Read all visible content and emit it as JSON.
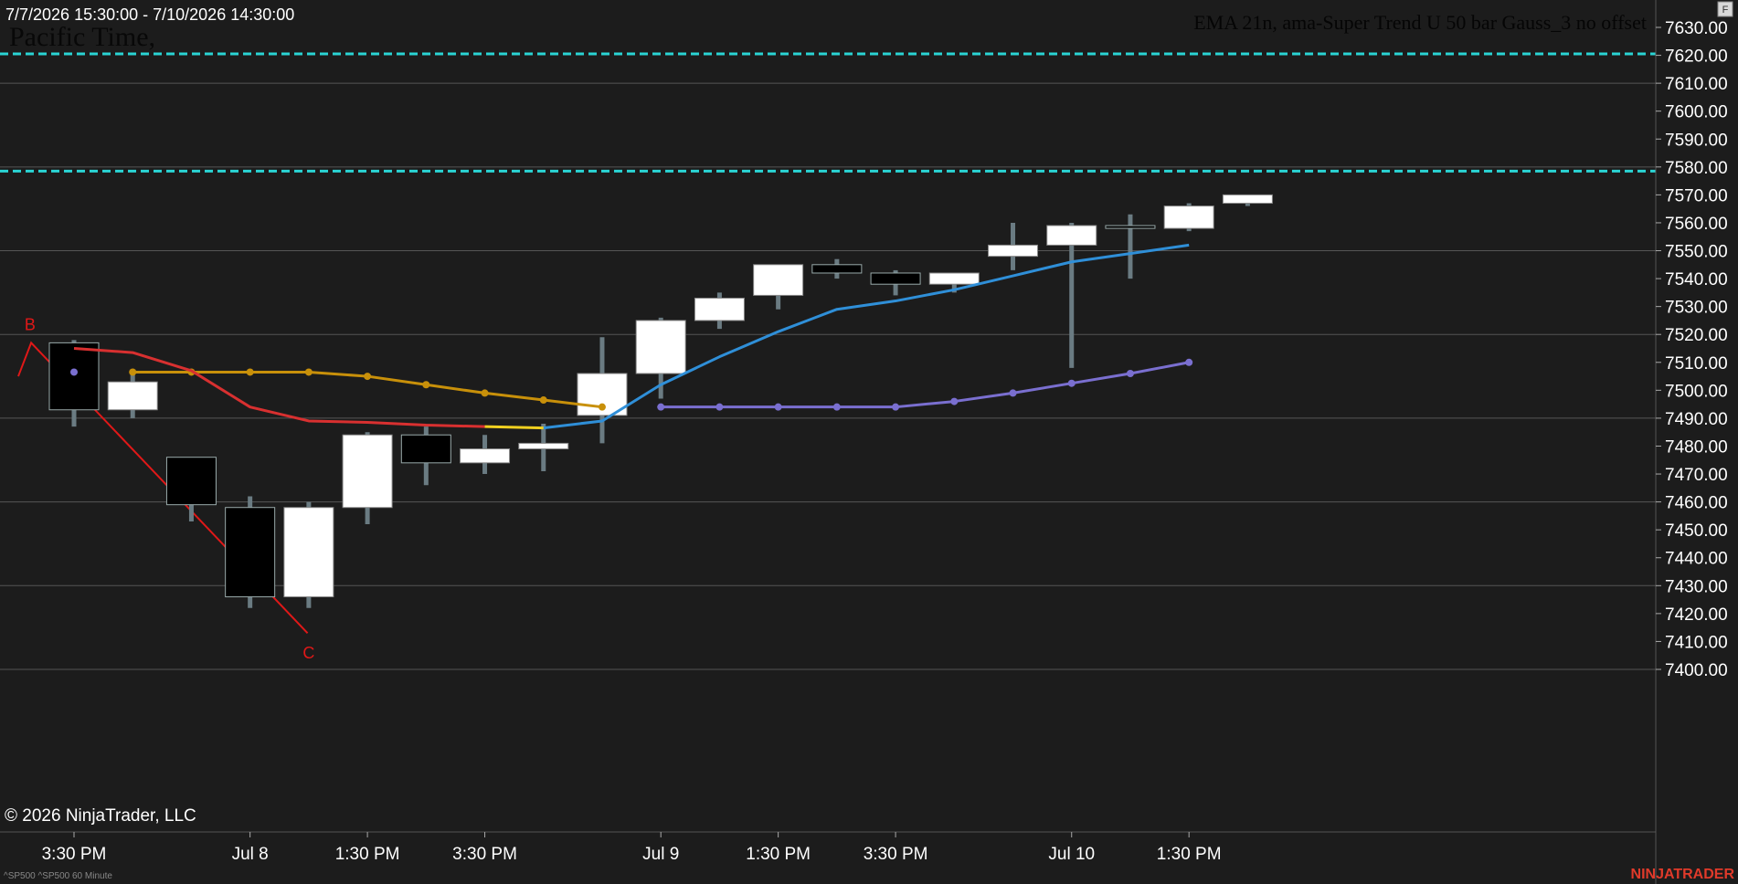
{
  "header": {
    "date_range": "7/7/2026 15:30:00 - 7/10/2026 14:30:00",
    "timezone": "Pacific Time,",
    "indicator_label": "EMA 21n, ama-Super Trend U 50 bar Gauss_3 no offset",
    "corner_button": "F"
  },
  "footer": {
    "copyright": "© 2026 NinjaTrader, LLC",
    "instrument": "^SP500 ^SP500 60 Minute",
    "brand": "NINJATRADER"
  },
  "colors": {
    "background": "#1c1c1c",
    "grid": "#555555",
    "dashed_level": "#2ad4d4",
    "up_candle": "#ffffff",
    "down_candle": "#000000",
    "wick": "#6a7b82",
    "ema": "#2f8fd8",
    "orange_line": "#c8900a",
    "red_line": "#d83030",
    "purple_line": "#7a6fd0",
    "yellow_line": "#f0d020",
    "brand": "#e03a2a"
  },
  "chart_data": {
    "type": "candlestick",
    "title": "EMA 21n, ama-Super Trend U 50 bar Gauss_3 no offset",
    "ylim": [
      7395,
      7635
    ],
    "y_ticks": [
      7630,
      7620,
      7610,
      7600,
      7590,
      7580,
      7570,
      7560,
      7550,
      7540,
      7530,
      7520,
      7510,
      7500,
      7490,
      7480,
      7470,
      7460,
      7450,
      7440,
      7430,
      7420,
      7410,
      7400
    ],
    "y_tick_labels": [
      "7630.00",
      "7620.00",
      "7610.00",
      "7600.00",
      "7590.00",
      "7580.00",
      "7570.00",
      "7560.00",
      "7550.00",
      "7540.00",
      "7530.00",
      "7520.00",
      "7510.00",
      "7500.00",
      "7490.00",
      "7480.00",
      "7470.00",
      "7460.00",
      "7450.00",
      "7440.00",
      "7430.00",
      "7420.00",
      "7410.00",
      "7400.00"
    ],
    "x_tick_labels": [
      {
        "bar": 1,
        "label": "3:30 PM"
      },
      {
        "bar": 4,
        "label": "Jul 8"
      },
      {
        "bar": 6,
        "label": "1:30 PM"
      },
      {
        "bar": 8,
        "label": "3:30 PM"
      },
      {
        "bar": 11,
        "label": "Jul 9"
      },
      {
        "bar": 13,
        "label": "1:30 PM"
      },
      {
        "bar": 15,
        "label": "3:30 PM"
      },
      {
        "bar": 18,
        "label": "Jul 10"
      },
      {
        "bar": 20,
        "label": "1:30 PM"
      }
    ],
    "dashed_levels": [
      7620.5,
      7578.5
    ],
    "candles": [
      {
        "bar": 1,
        "open": 7517,
        "high": 7518,
        "low": 7487,
        "close": 7493
      },
      {
        "bar": 2,
        "open": 7493,
        "high": 7506,
        "low": 7490,
        "close": 7503
      },
      {
        "bar": 3,
        "open": 7476,
        "high": 7476,
        "low": 7453,
        "close": 7459
      },
      {
        "bar": 4,
        "open": 7458,
        "high": 7462,
        "low": 7422,
        "close": 7426
      },
      {
        "bar": 5,
        "open": 7426,
        "high": 7460,
        "low": 7422,
        "close": 7458
      },
      {
        "bar": 6,
        "open": 7458,
        "high": 7485,
        "low": 7452,
        "close": 7484
      },
      {
        "bar": 7,
        "open": 7484,
        "high": 7487,
        "low": 7466,
        "close": 7474
      },
      {
        "bar": 8,
        "open": 7474,
        "high": 7484,
        "low": 7470,
        "close": 7479
      },
      {
        "bar": 9,
        "open": 7479,
        "high": 7488,
        "low": 7471,
        "close": 7481
      },
      {
        "bar": 10,
        "open": 7491,
        "high": 7519,
        "low": 7481,
        "close": 7506
      },
      {
        "bar": 11,
        "open": 7506,
        "high": 7526,
        "low": 7497,
        "close": 7525
      },
      {
        "bar": 12,
        "open": 7525,
        "high": 7535,
        "low": 7522,
        "close": 7533
      },
      {
        "bar": 13,
        "open": 7534,
        "high": 7545,
        "low": 7529,
        "close": 7545
      },
      {
        "bar": 14,
        "open": 7545,
        "high": 7547,
        "low": 7540,
        "close": 7542
      },
      {
        "bar": 15,
        "open": 7542,
        "high": 7543,
        "low": 7534,
        "close": 7538
      },
      {
        "bar": 16,
        "open": 7538,
        "high": 7542,
        "low": 7535,
        "close": 7542
      },
      {
        "bar": 17,
        "open": 7548,
        "high": 7560,
        "low": 7543,
        "close": 7552
      },
      {
        "bar": 18,
        "open": 7552,
        "high": 7560,
        "low": 7508,
        "close": 7559
      },
      {
        "bar": 19,
        "open": 7559,
        "high": 7563,
        "low": 7540,
        "close": 7558
      },
      {
        "bar": 20,
        "open": 7558,
        "high": 7567,
        "low": 7557,
        "close": 7566
      },
      {
        "bar": 21,
        "open": 7567,
        "high": 7570,
        "low": 7566,
        "close": 7570
      }
    ],
    "series": [
      {
        "key": "ema",
        "points": [
          [
            9,
            7486.5
          ],
          [
            10,
            7489
          ],
          [
            11,
            7502
          ],
          [
            12,
            7512
          ],
          [
            13,
            7521
          ],
          [
            14,
            7529
          ],
          [
            15,
            7532
          ],
          [
            16,
            7536
          ],
          [
            17,
            7541
          ],
          [
            18,
            7546
          ],
          [
            19,
            7549
          ],
          [
            20,
            7552
          ]
        ]
      },
      {
        "key": "orange",
        "dots": true,
        "points": [
          [
            2,
            7506.5
          ],
          [
            3,
            7506.5
          ],
          [
            4,
            7506.5
          ],
          [
            5,
            7506.5
          ],
          [
            6,
            7505
          ],
          [
            7,
            7502
          ],
          [
            8,
            7499
          ],
          [
            9,
            7496.5
          ],
          [
            10,
            7494
          ]
        ]
      },
      {
        "key": "red",
        "points": [
          [
            1,
            7515
          ],
          [
            2,
            7513.5
          ],
          [
            3,
            7507
          ],
          [
            4,
            7494
          ],
          [
            5,
            7489
          ],
          [
            6,
            7488.5
          ],
          [
            7,
            7487.5
          ],
          [
            8,
            7487
          ]
        ]
      },
      {
        "key": "yellow",
        "points": [
          [
            8,
            7487
          ],
          [
            9,
            7486.5
          ]
        ]
      },
      {
        "key": "purple",
        "dots": true,
        "points": [
          [
            11,
            7494
          ],
          [
            12,
            7494
          ],
          [
            13,
            7494
          ],
          [
            14,
            7494
          ],
          [
            15,
            7494
          ],
          [
            16,
            7496
          ],
          [
            17,
            7499
          ],
          [
            18,
            7502.5
          ],
          [
            19,
            7506
          ],
          [
            20,
            7510
          ]
        ]
      }
    ],
    "single_dots": [
      {
        "bar": 1,
        "value": 7506.5
      }
    ],
    "zigzag": {
      "points": [
        [
          0.05,
          7505
        ],
        [
          0.27,
          7517
        ],
        [
          4.98,
          7413
        ]
      ]
    },
    "zigzag_labels": [
      {
        "text": "B",
        "bar": 0.25,
        "value": 7521.5
      },
      {
        "text": "C",
        "bar": 5.0,
        "value": 7404
      }
    ]
  }
}
